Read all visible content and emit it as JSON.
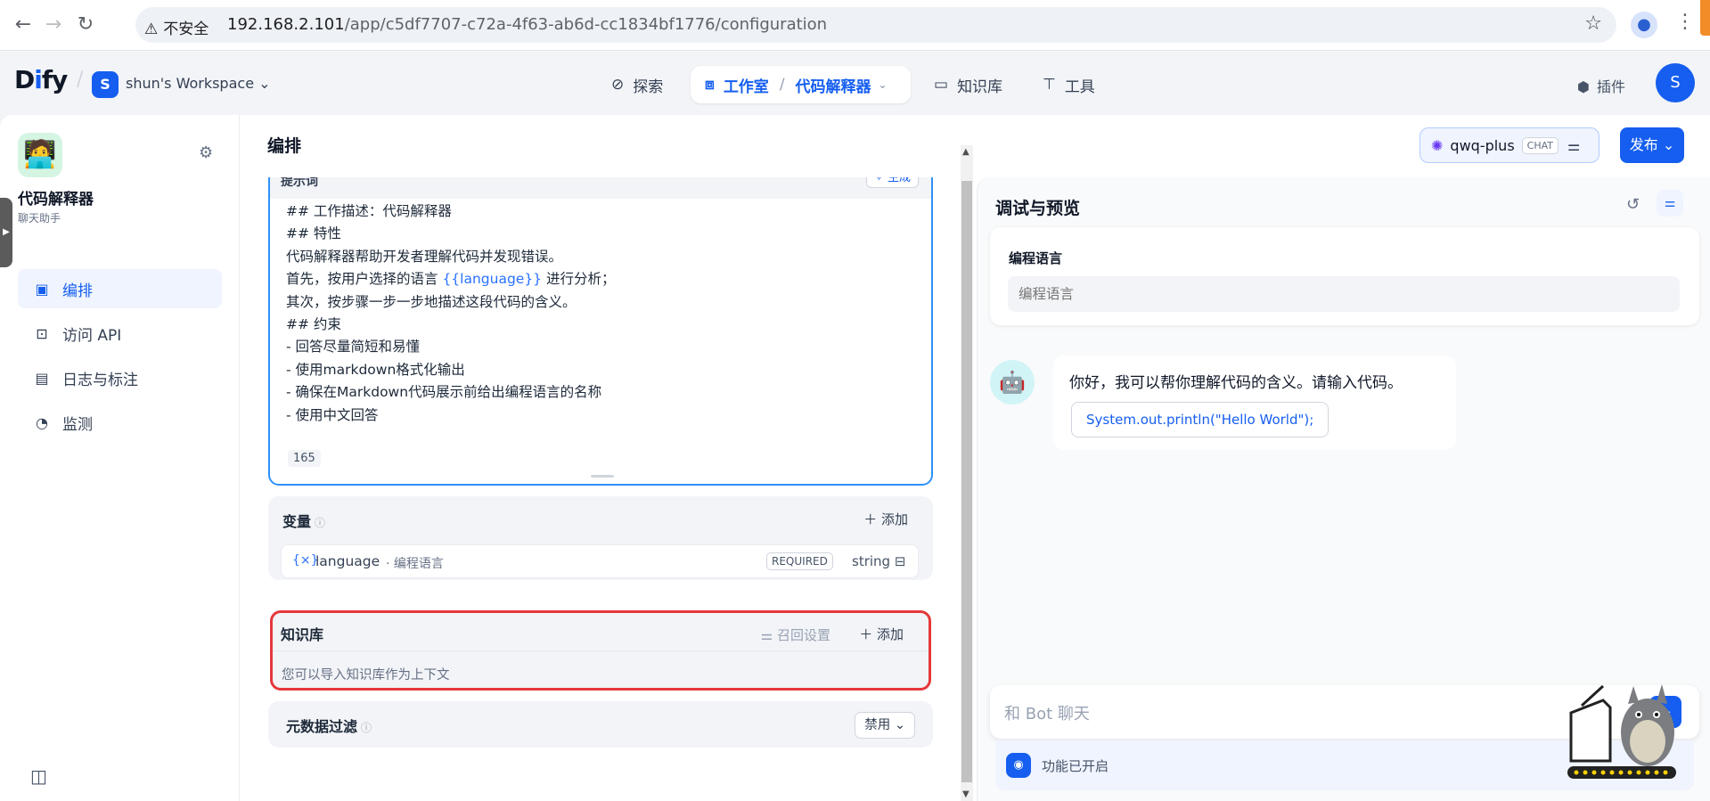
{
  "browser": {
    "security_label": "不安全",
    "url_host": "192.168.2.101",
    "url_path": "/app/c5df7707-c72a-4f63-ab6d-cc1834bf1776/configuration"
  },
  "header": {
    "logo": "Dify",
    "workspace_initial": "S",
    "workspace_name": "shun's Workspace",
    "nav": {
      "explore": "探索",
      "studio": "工作室",
      "current_app": "代码解释器",
      "knowledge": "知识库",
      "tools": "工具"
    },
    "plugins": "插件",
    "user_initial": "S"
  },
  "sidebar": {
    "app_name": "代码解释器",
    "app_type": "聊天助手",
    "items": [
      {
        "label": "编排",
        "icon": "layout-icon",
        "active": true
      },
      {
        "label": "访问 API",
        "icon": "terminal-icon",
        "active": false
      },
      {
        "label": "日志与标注",
        "icon": "doc-icon",
        "active": false
      },
      {
        "label": "监测",
        "icon": "gauge-icon",
        "active": false
      }
    ]
  },
  "main": {
    "title": "编排",
    "model_name": "qwq-plus",
    "model_badge": "CHAT",
    "publish": "发布"
  },
  "prompt": {
    "label": "提示词",
    "generate": "生成",
    "lines": [
      "## 工作描述：代码解释器",
      "## 特性",
      "代码解释器帮助开发者理解代码并发现错误。",
      "首先，按用户选择的语言 ",
      "其次，按步骤一步一步地描述这段代码的含义。",
      "## 约束",
      "- 回答尽量简短和易懂",
      "- 使用markdown格式化输出",
      "- 确保在Markdown代码展示前给出编程语言的名称",
      "- 使用中文回答"
    ],
    "line4_var": "{{language}}",
    "line4_tail": " 进行分析；",
    "count": "165"
  },
  "variables": {
    "title": "变量",
    "add": "添加",
    "var_name": "language",
    "var_desc": "· 编程语言",
    "required": "REQUIRED",
    "type": "string"
  },
  "knowledge": {
    "title": "知识库",
    "recall": "召回设置",
    "add": "添加",
    "hint": "您可以导入知识库作为上下文"
  },
  "metadata": {
    "title": "元数据过滤",
    "state": "禁用"
  },
  "preview": {
    "title": "调试与预览",
    "input_label": "编程语言",
    "input_placeholder": "编程语言",
    "greeting": "你好，我可以帮你理解代码的含义。请输入代码。",
    "suggestion": "System.out.println(\"Hello World\");",
    "chat_placeholder": "和 Bot 聊天",
    "feature_status": "功能已开启"
  },
  "colors": {
    "primary": "#155eef",
    "highlight_border": "#e5383b",
    "prompt_border": "#2e90fa"
  }
}
